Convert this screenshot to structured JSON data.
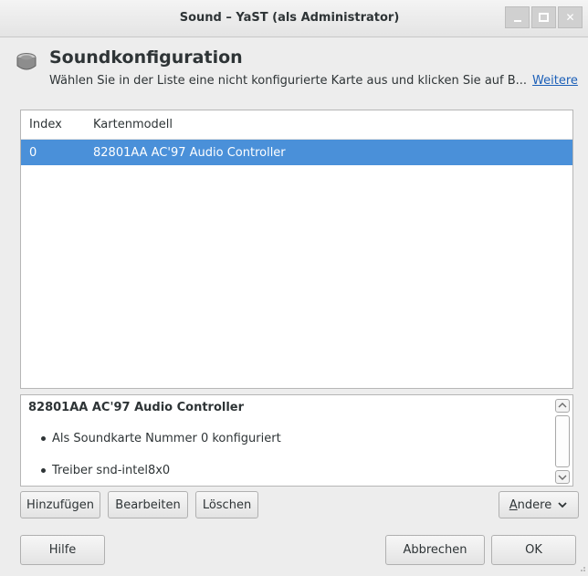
{
  "window": {
    "title": "Sound – YaST (als Administrator)",
    "controls": [
      "minimize-icon",
      "maximize-icon",
      "close-icon"
    ]
  },
  "header": {
    "icon": "speaker-icon",
    "title": "Soundkonfiguration",
    "description": "Wählen Sie in der Liste eine nicht konfigurierte Karte aus und klicken Sie auf B...",
    "more_link": "Weitere"
  },
  "table": {
    "columns": [
      "Index",
      "Kartenmodell"
    ],
    "rows": [
      {
        "index": "0",
        "model": "82801AA AC'97 Audio Controller",
        "selected": true
      }
    ]
  },
  "details": {
    "title": "82801AA AC'97 Audio Controller",
    "items": [
      "Als Soundkarte Nummer 0 konfiguriert",
      "Treiber snd-intel8x0"
    ]
  },
  "actions": {
    "add": "Hinzufügen",
    "edit": "Bearbeiten",
    "delete": "Löschen",
    "other_first": "A",
    "other_rest": "ndere"
  },
  "footer": {
    "help": "Hilfe",
    "cancel": "Abbrechen",
    "ok": "OK"
  },
  "colors": {
    "selection": "#4a90d9",
    "link": "#1b5fb8",
    "window_control": "#d0d0d0"
  }
}
